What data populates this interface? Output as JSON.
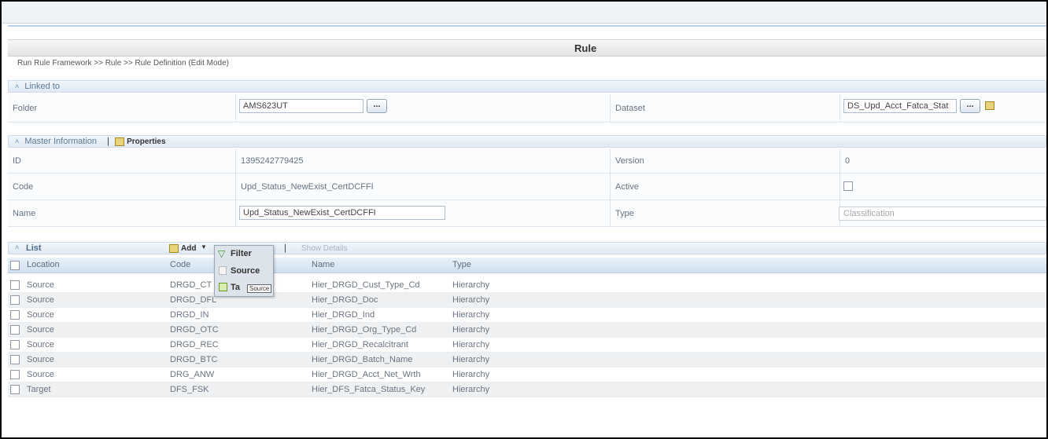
{
  "window": {
    "title": "Rule"
  },
  "breadcrumb": "Run Rule Framework >> Rule >> Rule Definition (Edit Mode)",
  "linked_to": {
    "header": "Linked to",
    "folder_label": "Folder",
    "folder_value": "AMS623UT",
    "dataset_label": "Dataset",
    "dataset_value": "DS_Upd_Acct_Fatca_Stat",
    "browse_label": "..."
  },
  "master_info": {
    "header": "Master Information",
    "properties_label": "Properties",
    "id_label": "ID",
    "id_value": "1395242779425",
    "version_label": "Version",
    "version_value": "0",
    "code_label": "Code",
    "code_value": "Upd_Status_NewExist_CertDCFFI",
    "active_label": "Active",
    "name_label": "Name",
    "name_value": "Upd_Status_NewExist_CertDCFFI",
    "type_label": "Type",
    "type_value": "Classification"
  },
  "list": {
    "header": "List",
    "add_label": "Add",
    "show_details_label": "Show Details",
    "columns": [
      "Location",
      "Code",
      "Name",
      "Type"
    ],
    "rows": [
      {
        "location": "Source",
        "code": "DRGD_CT",
        "name": "Hier_DRGD_Cust_Type_Cd",
        "type": "Hierarchy"
      },
      {
        "location": "Source",
        "code": "DRGD_DFL",
        "name": "Hier_DRGD_Doc",
        "type": "Hierarchy"
      },
      {
        "location": "Source",
        "code": "DRGD_IN",
        "name": "Hier_DRGD_Ind",
        "type": "Hierarchy"
      },
      {
        "location": "Source",
        "code": "DRGD_OTC",
        "name": "Hier_DRGD_Org_Type_Cd",
        "type": "Hierarchy"
      },
      {
        "location": "Source",
        "code": "DRGD_REC",
        "name": "Hier_DRGD_Recalcitrant",
        "type": "Hierarchy"
      },
      {
        "location": "Source",
        "code": "DRGD_BTC",
        "name": "Hier_DRGD_Batch_Name",
        "type": "Hierarchy"
      },
      {
        "location": "Source",
        "code": "DRG_ANW",
        "name": "Hier_DRGD_Acct_Net_Wrth",
        "type": "Hierarchy"
      },
      {
        "location": "Target",
        "code": "DFS_FSK",
        "name": "Hier_DFS_Fatca_Status_Key",
        "type": "Hierarchy"
      }
    ]
  },
  "add_menu": {
    "items": [
      "Filter",
      "Source",
      "Ta"
    ],
    "tooltip": "Source"
  },
  "colors": {
    "accent": "#5d7a95",
    "header_bg": "#dfe9f4"
  },
  "icons": [
    "chevron-up-icon",
    "properties-icon",
    "filter-icon",
    "add-icon",
    "dataset-icon",
    "checkbox-icon"
  ]
}
